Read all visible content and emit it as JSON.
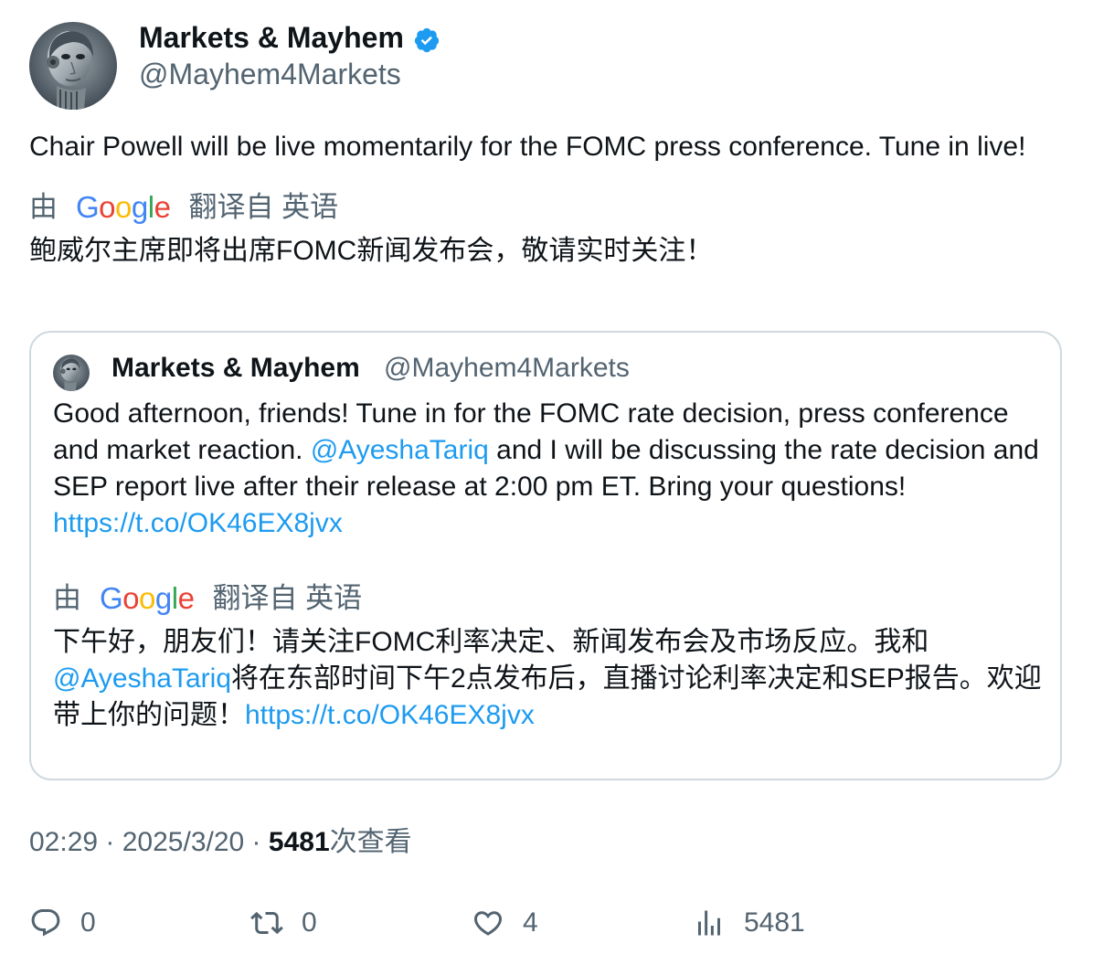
{
  "author": {
    "name": "Markets & Mayhem",
    "handle": "@Mayhem4Markets",
    "verified": true,
    "avatar_icon": "robot-avatar-icon"
  },
  "tweet": {
    "text": "Chair Powell will be live momentarily for the FOMC press conference. Tune in live!",
    "translation": {
      "by_label": "由",
      "provider": "Google",
      "from_label": "翻译自 英语",
      "text": "鲍威尔主席即将出席FOMC新闻发布会，敬请实时关注！"
    }
  },
  "quote": {
    "name": "Markets & Mayhem",
    "handle": "@Mayhem4Markets",
    "text_part1": "Good afternoon, friends! Tune in for the FOMC rate decision, press conference and market reaction. ",
    "mention": "@AyeshaTariq",
    "text_part2": " and I will be discussing the rate decision and SEP report live after their release at 2:00 pm ET. Bring your questions! ",
    "link": "https://t.co/OK46EX8jvx",
    "translation": {
      "by_label": "由",
      "provider": "Google",
      "from_label": "翻译自 英语",
      "text_part1": "下午好，朋友们！请关注FOMC利率决定、新闻发布会及市场反应。我和",
      "mention": "@AyeshaTariq",
      "text_part2": "将在东部时间下午2点发布后，直播讨论利率决定和SEP报告。欢迎带上你的问题！",
      "link": "https://t.co/OK46EX8jvx"
    }
  },
  "meta": {
    "time": "02:29",
    "separator": " · ",
    "date": "2025/3/20",
    "views_count": "5481",
    "views_label": "次查看"
  },
  "actions": {
    "replies": "0",
    "retweets": "0",
    "likes": "4",
    "views": "5481"
  },
  "colors": {
    "text": "#0f1419",
    "secondary": "#536471",
    "link": "#1d9bf0",
    "verified": "#1d9bf0",
    "border": "#cfd9de"
  }
}
